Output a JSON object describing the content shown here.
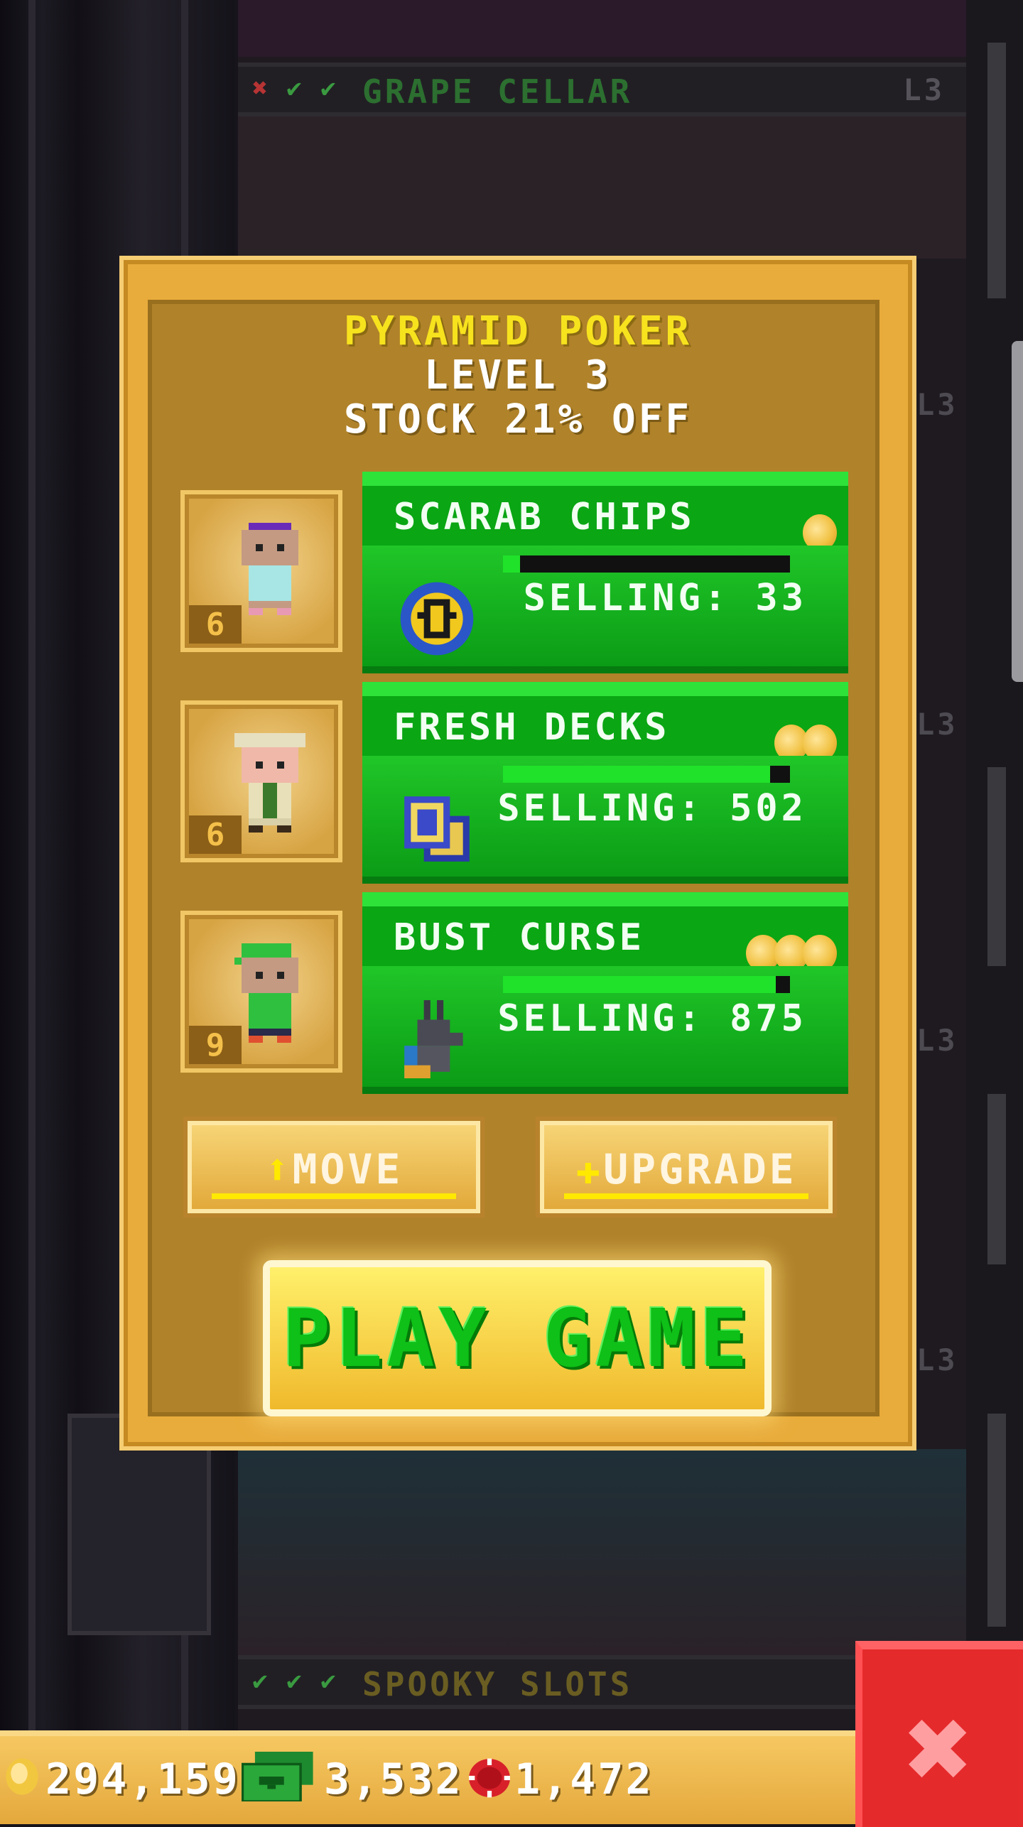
{
  "dialog": {
    "title": "PYRAMID POKER",
    "level": "LEVEL 3",
    "stock": "STOCK 21% OFF",
    "move_label": "MOVE",
    "upgrade_label": "UPGRADE",
    "play_label": "PLAY GAME",
    "colors": {
      "title": "#f7e21e",
      "panel": "#e8ac3c",
      "card": "#16b21e"
    }
  },
  "products": [
    {
      "name": "SCARAB CHIPS",
      "selling": "SELLING: 33",
      "worker_level": "6",
      "tier": 1,
      "stock_fraction": 0.06,
      "icon": "scarab-chip-icon"
    },
    {
      "name": "FRESH DECKS",
      "selling": "SELLING: 502",
      "worker_level": "6",
      "tier": 2,
      "stock_fraction": 0.93,
      "icon": "card-deck-icon"
    },
    {
      "name": "BUST CURSE",
      "selling": "SELLING: 875",
      "worker_level": "9",
      "tier": 3,
      "stock_fraction": 0.95,
      "icon": "anubis-bust-icon"
    }
  ],
  "background": {
    "floors": [
      {
        "name": "GRAPE CELLAR",
        "level": "L3",
        "checks": [
          "fail",
          "ok",
          "ok"
        ]
      },
      {
        "name": "SPOOKY SLOTS",
        "level": "",
        "checks": [
          "ok",
          "ok",
          "ok"
        ]
      }
    ],
    "side_levels": [
      "L3",
      "L3",
      "L3",
      "L3",
      "L3"
    ]
  },
  "resources": {
    "coins": "294,159",
    "bux": "3,532",
    "chips": "1,472"
  }
}
